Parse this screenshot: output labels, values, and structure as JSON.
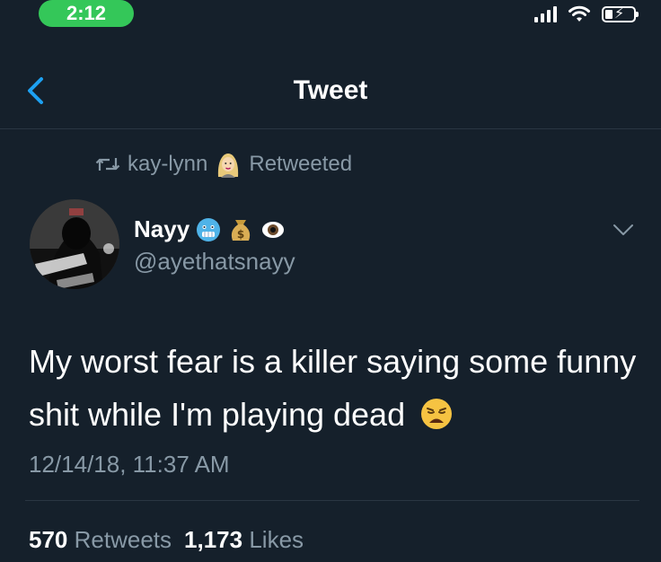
{
  "status_bar": {
    "time": "2:12"
  },
  "nav": {
    "title": "Tweet"
  },
  "retweet": {
    "user": "kay-lynn",
    "label": "Retweeted"
  },
  "author": {
    "display_name": "Nayy",
    "handle": "@ayethatsnayy"
  },
  "tweet": {
    "text": "My worst fear is a killer saying some funny shit while I'm playing dead",
    "timestamp": "12/14/18, 11:37 AM"
  },
  "stats": {
    "retweets_count": "570",
    "retweets_label": "Retweets",
    "likes_count": "1,173",
    "likes_label": "Likes"
  },
  "icons": {
    "back": "chevron-left-icon",
    "retweet": "retweet-icon",
    "more": "chevron-down-icon",
    "emoji_after_text": "weary-face-emoji",
    "name_emojis": [
      "cold-face-emoji",
      "money-bag-emoji",
      "eye-emoji"
    ],
    "retweeter_emoji": "woman-emoji"
  },
  "colors": {
    "background": "#15202b",
    "accent": "#1da1f2",
    "muted": "#8899a6",
    "time_pill": "#34c759"
  }
}
